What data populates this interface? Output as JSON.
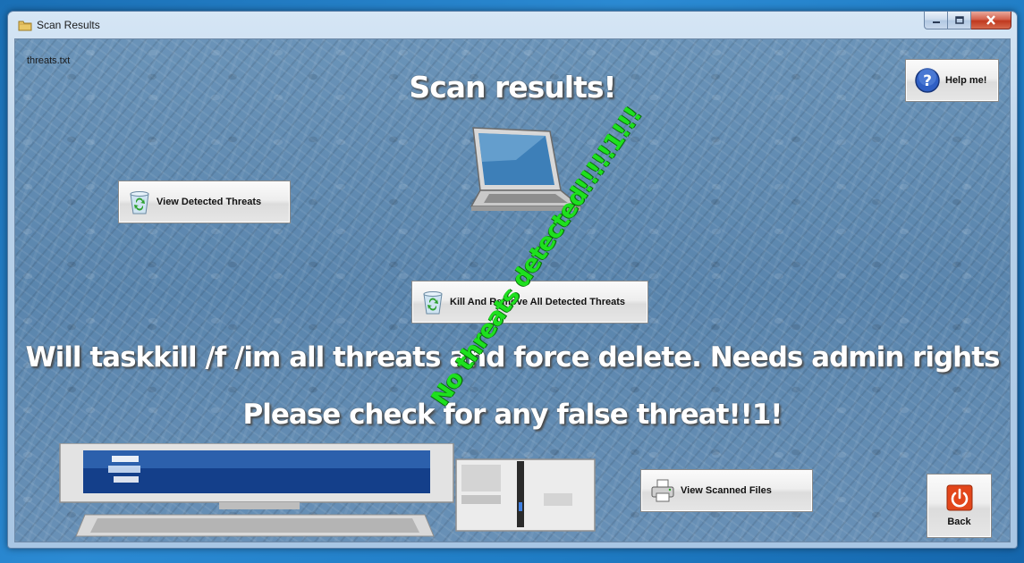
{
  "window": {
    "title": "Scan Results"
  },
  "file_label": "threats.txt",
  "headings": {
    "scan_results": "Scan results!",
    "kill_note": "Will taskkill /f /im all threats and force delete. Needs admin rights",
    "check_note": "Please check for any false threat!!1!"
  },
  "status_stamp": "No threats detected!!!!!1!!!",
  "buttons": {
    "help": "Help me!",
    "view_detected": "View Detected Threats",
    "kill_remove": "Kill And Remove All Detected Threats",
    "view_scanned": "View Scanned Files",
    "back": "Back"
  },
  "icons": {
    "help": "help-icon",
    "view_detected": "recycle-bin-icon",
    "kill_remove": "recycle-bin-icon",
    "view_scanned": "printer-icon",
    "back": "power-icon"
  },
  "colors": {
    "stamp": "#1ee01e",
    "heading_text": "#ffffff"
  }
}
